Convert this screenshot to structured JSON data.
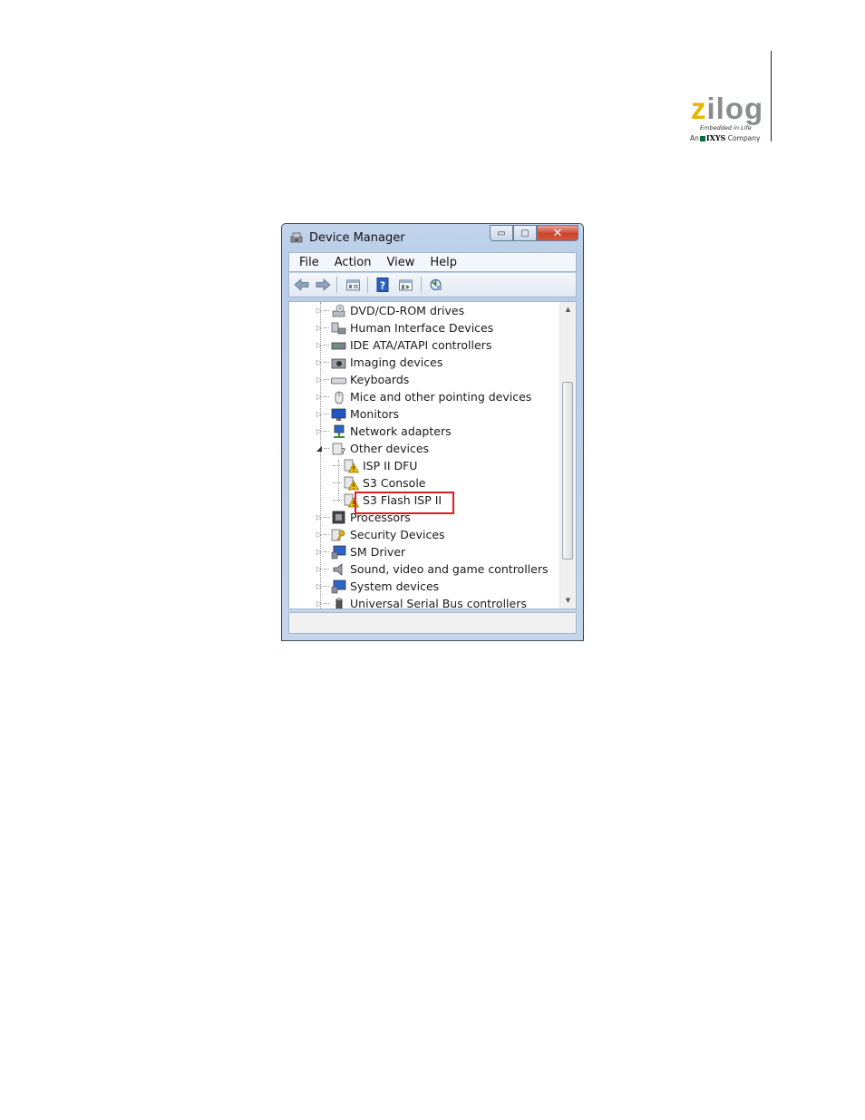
{
  "logo": {
    "word_z": "z",
    "word_rest": "ilog",
    "tagline": "Embedded in Life",
    "ixys_prefix": "An",
    "ixys_name": "IXYS",
    "ixys_suffix": "Company",
    "brand_color": "#e8b400",
    "ixys_color": "#0a6e3f"
  },
  "window": {
    "title": "Device Manager",
    "title_icon": "device-manager-icon",
    "caption_buttons": {
      "minimize": "▭",
      "maximize": "▢",
      "close": "✕"
    },
    "menu": [
      "File",
      "Action",
      "View",
      "Help"
    ],
    "toolbar_icons": [
      "back-arrow-icon",
      "forward-arrow-icon",
      "properties-icon",
      "help-icon",
      "update-driver-icon",
      "scan-hardware-icon"
    ],
    "tree": [
      {
        "label": "DVD/CD-ROM drives",
        "icon": "dvd-drive-icon",
        "expander": "▷",
        "level": 0
      },
      {
        "label": "Human Interface Devices",
        "icon": "hid-icon",
        "expander": "▷",
        "level": 0
      },
      {
        "label": "IDE ATA/ATAPI controllers",
        "icon": "ide-controller-icon",
        "expander": "▷",
        "level": 0
      },
      {
        "label": "Imaging devices",
        "icon": "camera-icon",
        "expander": "▷",
        "level": 0
      },
      {
        "label": "Keyboards",
        "icon": "keyboard-icon",
        "expander": "▷",
        "level": 0
      },
      {
        "label": "Mice and other pointing devices",
        "icon": "mouse-icon",
        "expander": "▷",
        "level": 0
      },
      {
        "label": "Monitors",
        "icon": "monitor-icon",
        "expander": "▷",
        "level": 0
      },
      {
        "label": "Network adapters",
        "icon": "network-icon",
        "expander": "▷",
        "level": 0
      },
      {
        "label": "Other devices",
        "icon": "other-devices-icon",
        "expander": "◢",
        "level": 0
      },
      {
        "label": "ISP II DFU",
        "icon": "warning-device-icon",
        "expander": "",
        "level": 1
      },
      {
        "label": "S3 Console",
        "icon": "warning-device-icon",
        "expander": "",
        "level": 1
      },
      {
        "label": "S3 Flash ISP II",
        "icon": "warning-device-icon",
        "expander": "",
        "level": 1
      },
      {
        "label": "Processors",
        "icon": "processor-icon",
        "expander": "▷",
        "level": 0
      },
      {
        "label": "Security Devices",
        "icon": "key-icon",
        "expander": "▷",
        "level": 0
      },
      {
        "label": "SM Driver",
        "icon": "system-icon",
        "expander": "▷",
        "level": 0
      },
      {
        "label": "Sound, video and game controllers",
        "icon": "speaker-icon",
        "expander": "▷",
        "level": 0
      },
      {
        "label": "System devices",
        "icon": "system-icon",
        "expander": "▷",
        "level": 0
      },
      {
        "label": "Universal Serial Bus controllers",
        "icon": "usb-icon",
        "expander": "▷",
        "level": 0
      }
    ],
    "highlighted_item": "S3 Flash ISP II",
    "highlight_color": "#e21a22"
  }
}
